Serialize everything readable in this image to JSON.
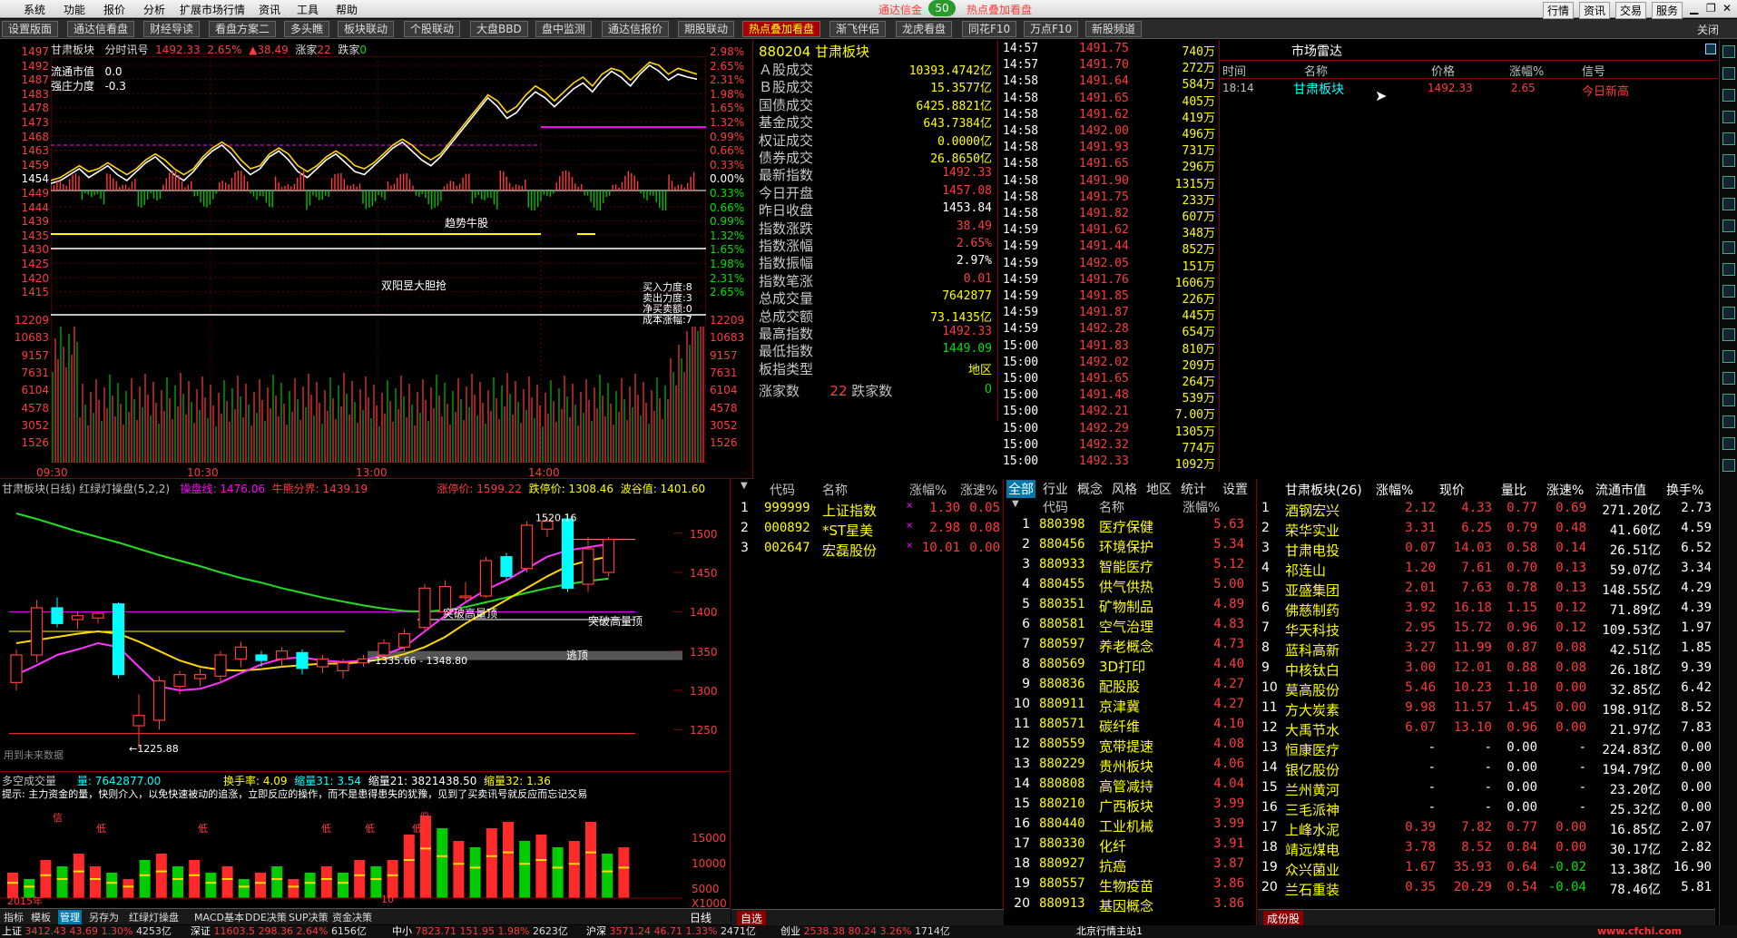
{
  "menu": {
    "items": [
      "系统",
      "功能",
      "报价",
      "分析",
      "扩展市场行情",
      "资讯",
      "工具",
      "帮助"
    ],
    "top_alerts": [
      "通达信金",
      "热点叠加看盘"
    ],
    "badge": "50",
    "right_buttons": [
      "行情",
      "资讯",
      "交易",
      "服务"
    ]
  },
  "tabs": [
    "设置版面",
    "通达信看盘",
    "财经导读",
    "看盘方案二",
    "多头瞧",
    "板块联动",
    "个股联动",
    "大盘BBD",
    "盘中监测",
    "通达信报价",
    "期股联动",
    "热点叠加看盘",
    "渐飞伴侣",
    "龙虎看盘",
    "同花F10",
    "万点F10",
    "新股频道"
  ],
  "active_tab": "热点叠加看盘",
  "close_label": "关闭",
  "intraday": {
    "header": {
      "name": "甘肃板块",
      "mode": "分时讯号",
      "price": "1492.33",
      "pct": "2.65%",
      "chg": "▲38.49",
      "up_label": "涨家",
      "up": "22",
      "down_label": "跌家",
      "down": "0"
    },
    "overlay1": [
      "流通市值",
      "0.0"
    ],
    "overlay2": [
      "强庄力度",
      "-0.3"
    ],
    "left_ticks": [
      "1497",
      "1492",
      "1487",
      "1483",
      "1478",
      "1473",
      "1468",
      "1463",
      "1459",
      "1454",
      "1449",
      "1444",
      "1439",
      "1435",
      "1430",
      "1425",
      "1420",
      "1415",
      "12209",
      "10683",
      "9157",
      "7631",
      "6104",
      "4578",
      "3052",
      "1526"
    ],
    "right_ticks": [
      "2.98%",
      "2.65%",
      "2.31%",
      "1.98%",
      "1.65%",
      "1.32%",
      "0.99%",
      "0.66%",
      "0.33%",
      "0.00%",
      "0.33%",
      "0.66%",
      "0.99%",
      "1.32%",
      "1.65%",
      "1.98%",
      "2.31%",
      "2.65%",
      "12209",
      "10683",
      "9157",
      "7631",
      "6104",
      "4578",
      "3052",
      "1526"
    ],
    "time_labels": [
      "09:30",
      "10:30",
      "13:00",
      "14:00"
    ],
    "annotations": {
      "trend": "趋势牛股",
      "yang": "双阳昱大胆抢",
      "buy": "买入力度:8",
      "sell": "卖出力度:3",
      "net": "净买卖额:0",
      "cost": "成本涨幅:7"
    },
    "series": {
      "price_white": [
        1457,
        1458,
        1460,
        1462,
        1459,
        1461,
        1463,
        1460,
        1458,
        1461,
        1464,
        1466,
        1463,
        1460,
        1458,
        1461,
        1465,
        1468,
        1470,
        1467,
        1463,
        1460,
        1462,
        1466,
        1468,
        1465,
        1461,
        1459,
        1462,
        1465,
        1467,
        1464,
        1461,
        1460,
        1463,
        1466,
        1469,
        1471,
        1468,
        1465,
        1463,
        1466,
        1470,
        1474,
        1478,
        1482,
        1486,
        1483,
        1479,
        1481,
        1485,
        1488,
        1486,
        1483,
        1486,
        1489,
        1491,
        1488,
        1492,
        1495,
        1493,
        1490,
        1494,
        1497,
        1495,
        1492,
        1494,
        1493,
        1492.3
      ],
      "avg_yellow": [
        1458,
        1459,
        1461,
        1463,
        1461,
        1462,
        1464,
        1462,
        1460,
        1462,
        1465,
        1467,
        1465,
        1462,
        1460,
        1462,
        1466,
        1469,
        1471,
        1469,
        1465,
        1462,
        1463,
        1467,
        1469,
        1467,
        1463,
        1461,
        1463,
        1466,
        1468,
        1466,
        1463,
        1462,
        1464,
        1467,
        1470,
        1472,
        1470,
        1467,
        1465,
        1467,
        1471,
        1475,
        1479,
        1483,
        1487,
        1485,
        1481,
        1483,
        1487,
        1490,
        1488,
        1485,
        1488,
        1491,
        1493,
        1490,
        1494,
        1496,
        1495,
        1492,
        1495,
        1498,
        1497,
        1494,
        1496,
        1495,
        1494
      ]
    }
  },
  "quote": {
    "code": "880204",
    "name": "甘肃板块",
    "rows": [
      [
        "Ａ股成交",
        "10393.4742亿",
        "yel"
      ],
      [
        "Ｂ股成交",
        "15.3577亿",
        "yel"
      ],
      [
        "国债成交",
        "6425.8821亿",
        "yel"
      ],
      [
        "基金成交",
        "643.7384亿",
        "yel"
      ],
      [
        "权证成交",
        "0.0000亿",
        "yel"
      ],
      [
        "债券成交",
        "26.8650亿",
        "yel"
      ],
      [
        "最新指数",
        "1492.33",
        "red"
      ],
      [
        "今日开盘",
        "1457.08",
        "red"
      ],
      [
        "昨日收盘",
        "1453.84",
        "wht"
      ],
      [
        "指数涨跌",
        "38.49",
        "red"
      ],
      [
        "指数涨幅",
        "2.65%",
        "red"
      ],
      [
        "指数振幅",
        "2.97%",
        "wht"
      ],
      [
        "指数笔涨",
        "0.01",
        "red"
      ],
      [
        "总成交量",
        "7642877",
        "yel"
      ],
      [
        "总成交额",
        "73.1435亿",
        "yel"
      ],
      [
        "最高指数",
        "1492.33",
        "red"
      ],
      [
        "最低指数",
        "1449.09",
        "grn"
      ],
      [
        "板指类型",
        "地区",
        "yel"
      ]
    ],
    "updown_label": "涨家数",
    "up": "22",
    "down_label": "跌家数",
    "down": "0"
  },
  "ticks": [
    [
      "14:57",
      "1491.75",
      "740万"
    ],
    [
      "14:57",
      "1491.70",
      "272万"
    ],
    [
      "14:58",
      "1491.64",
      "584万"
    ],
    [
      "14:58",
      "1491.65",
      "405万"
    ],
    [
      "14:58",
      "1491.62",
      "419万"
    ],
    [
      "14:58",
      "1492.00",
      "496万"
    ],
    [
      "14:58",
      "1491.93",
      "731万"
    ],
    [
      "14:58",
      "1491.65",
      "296万"
    ],
    [
      "14:58",
      "1491.90",
      "1315万"
    ],
    [
      "14:58",
      "1491.75",
      "233万"
    ],
    [
      "14:58",
      "1491.82",
      "607万"
    ],
    [
      "14:59",
      "1491.62",
      "348万"
    ],
    [
      "14:59",
      "1491.44",
      "852万"
    ],
    [
      "14:59",
      "1492.05",
      "151万"
    ],
    [
      "14:59",
      "1491.76",
      "1606万"
    ],
    [
      "14:59",
      "1491.85",
      "226万"
    ],
    [
      "14:59",
      "1491.87",
      "445万"
    ],
    [
      "14:59",
      "1492.28",
      "654万"
    ],
    [
      "15:00",
      "1491.83",
      "810万"
    ],
    [
      "15:00",
      "1492.02",
      "209万"
    ],
    [
      "15:00",
      "1491.65",
      "264万"
    ],
    [
      "15:00",
      "1491.48",
      "539万"
    ],
    [
      "15:00",
      "1492.21",
      "7.00万"
    ],
    [
      "15:00",
      "1492.29",
      "1305万"
    ],
    [
      "15:00",
      "1492.32",
      "774万"
    ],
    [
      "15:00",
      "1492.33",
      "1092万"
    ]
  ],
  "radar": {
    "title": "市场雷达",
    "headers": [
      "时间",
      "名称",
      "价格",
      "涨幅%",
      "信号"
    ],
    "row": [
      "18:14",
      "甘肃板块",
      "1492.33",
      "2.65",
      "今日新高"
    ]
  },
  "kline": {
    "header": {
      "name": "甘肃板块(日线) 红绿灯操盘(5,2,2)",
      "l1": "操盘线: 1476.06",
      "l2": "牛熊分界: 1439.19",
      "l3": "涨停价: 1599.22",
      "l4": "跌停价: 1308.46",
      "l5": "波谷值: 1401.60"
    },
    "yticks": [
      "1500",
      "1450",
      "1400",
      "1350",
      "1300",
      "1250"
    ],
    "labels": {
      "high": "1520.16",
      "low": "1225.88",
      "range": "1335.66 - 1348.80",
      "tb1": "突破高量顶",
      "tb2": "突破高量顶",
      "top": "逃顶",
      "future": "用到未来数据"
    },
    "candles": [
      {
        "o": 1310,
        "h": 1352,
        "l": 1300,
        "c": 1345
      },
      {
        "o": 1345,
        "h": 1415,
        "l": 1335,
        "c": 1405
      },
      {
        "o": 1405,
        "h": 1418,
        "l": 1380,
        "c": 1385
      },
      {
        "o": 1390,
        "h": 1400,
        "l": 1378,
        "c": 1395
      },
      {
        "o": 1392,
        "h": 1400,
        "l": 1385,
        "c": 1398
      },
      {
        "o": 1410,
        "h": 1412,
        "l": 1315,
        "c": 1320
      },
      {
        "o": 1255,
        "h": 1295,
        "l": 1226,
        "c": 1268
      },
      {
        "o": 1262,
        "h": 1318,
        "l": 1250,
        "c": 1312
      },
      {
        "o": 1305,
        "h": 1325,
        "l": 1295,
        "c": 1320
      },
      {
        "o": 1315,
        "h": 1328,
        "l": 1305,
        "c": 1320
      },
      {
        "o": 1318,
        "h": 1350,
        "l": 1310,
        "c": 1345
      },
      {
        "o": 1340,
        "h": 1362,
        "l": 1330,
        "c": 1355
      },
      {
        "o": 1345,
        "h": 1350,
        "l": 1330,
        "c": 1338
      },
      {
        "o": 1340,
        "h": 1355,
        "l": 1330,
        "c": 1350
      },
      {
        "o": 1348,
        "h": 1352,
        "l": 1320,
        "c": 1328
      },
      {
        "o": 1330,
        "h": 1345,
        "l": 1322,
        "c": 1340
      },
      {
        "o": 1325,
        "h": 1340,
        "l": 1315,
        "c": 1335
      },
      {
        "o": 1335,
        "h": 1345,
        "l": 1330,
        "c": 1340
      },
      {
        "o": 1345,
        "h": 1365,
        "l": 1340,
        "c": 1360
      },
      {
        "o": 1355,
        "h": 1378,
        "l": 1350,
        "c": 1372
      },
      {
        "o": 1380,
        "h": 1435,
        "l": 1375,
        "c": 1430
      },
      {
        "o": 1400,
        "h": 1440,
        "l": 1395,
        "c": 1432
      },
      {
        "o": 1418,
        "h": 1438,
        "l": 1412,
        "c": 1420
      },
      {
        "o": 1420,
        "h": 1470,
        "l": 1418,
        "c": 1465
      },
      {
        "o": 1470,
        "h": 1475,
        "l": 1440,
        "c": 1445
      },
      {
        "o": 1455,
        "h": 1515,
        "l": 1450,
        "c": 1510
      },
      {
        "o": 1505,
        "h": 1520,
        "l": 1495,
        "c": 1515
      },
      {
        "o": 1518,
        "h": 1525,
        "l": 1425,
        "c": 1430
      },
      {
        "o": 1435,
        "h": 1495,
        "l": 1425,
        "c": 1480
      },
      {
        "o": 1450,
        "h": 1495,
        "l": 1445,
        "c": 1492
      }
    ],
    "ma_magenta": [
      1320,
      1332,
      1345,
      1352,
      1360,
      1355,
      1330,
      1305,
      1300,
      1302,
      1310,
      1322,
      1333,
      1340,
      1342,
      1338,
      1336,
      1338,
      1345,
      1355,
      1375,
      1395,
      1412,
      1428,
      1440,
      1455,
      1470,
      1478,
      1482,
      1486
    ],
    "ma_yellow": [
      1360,
      1364,
      1368,
      1372,
      1375,
      1372,
      1362,
      1350,
      1338,
      1330,
      1326,
      1325,
      1327,
      1330,
      1332,
      1334,
      1334,
      1336,
      1340,
      1346,
      1355,
      1368,
      1385,
      1400,
      1415,
      1430,
      1445,
      1458,
      1465,
      1470
    ],
    "ma_green": [
      1525,
      1518,
      1510,
      1502,
      1495,
      1488,
      1480,
      1472,
      1465,
      1458,
      1450,
      1443,
      1437,
      1430,
      1424,
      1418,
      1413,
      1408,
      1404,
      1401,
      1400,
      1402,
      1406,
      1412,
      1418,
      1424,
      1430,
      1435,
      1439,
      1442
    ]
  },
  "volume": {
    "header": {
      "name": "多空成交量",
      "q": "量: 7642877.00",
      "turn": "换手率: 4.09",
      "s1": "缩量31: 3.54",
      "s2": "缩量21: 3821438.50",
      "s3": "缩量32: 1.36"
    },
    "desc": "提示: 主力资金的量，快则介入，以免快速被动的追涨，立即反应的操作，而不是患得患失的犹豫，见到了买卖讯号就反应而忘记交易",
    "marks": [
      "信",
      "低",
      "低",
      "低",
      "低",
      "低",
      "信"
    ],
    "yticks": [
      "15000",
      "10000",
      "5000",
      "X1000"
    ],
    "years": [
      "2015年",
      "10"
    ],
    "bars": [
      [
        4,
        "r"
      ],
      [
        3,
        "g"
      ],
      [
        6,
        "r"
      ],
      [
        5,
        "g"
      ],
      [
        7,
        "r"
      ],
      [
        5,
        "r"
      ],
      [
        4,
        "g"
      ],
      [
        3,
        "r"
      ],
      [
        6,
        "g"
      ],
      [
        7,
        "r"
      ],
      [
        5,
        "g"
      ],
      [
        6,
        "r"
      ],
      [
        4,
        "g"
      ],
      [
        5,
        "r"
      ],
      [
        3,
        "g"
      ],
      [
        4,
        "r"
      ],
      [
        5,
        "g"
      ],
      [
        3,
        "r"
      ],
      [
        4,
        "g"
      ],
      [
        5,
        "r"
      ],
      [
        4,
        "g"
      ],
      [
        6,
        "r"
      ],
      [
        5,
        "g"
      ],
      [
        6,
        "r"
      ],
      [
        10,
        "r"
      ],
      [
        13,
        "r"
      ],
      [
        11,
        "g"
      ],
      [
        9,
        "r"
      ],
      [
        8,
        "g"
      ],
      [
        11,
        "r"
      ],
      [
        12,
        "r"
      ],
      [
        9,
        "g"
      ],
      [
        10,
        "r"
      ],
      [
        8,
        "g"
      ],
      [
        9,
        "r"
      ],
      [
        12,
        "r"
      ],
      [
        7,
        "g"
      ],
      [
        8,
        "r"
      ]
    ]
  },
  "bottom_tabs": [
    "指标",
    "模板",
    "管理",
    "另存为",
    "红绿灯操盘",
    "MACD基本",
    "DDE决策",
    "SUP决策",
    "资金决策"
  ],
  "period_label": "日线",
  "watch": {
    "headers": [
      "代码",
      "名称",
      "涨幅%",
      "涨速%"
    ],
    "rows": [
      [
        "1",
        "999999",
        "上证指数",
        "1.30",
        "0.05"
      ],
      [
        "2",
        "000892",
        "*ST星美",
        "2.98",
        "0.08"
      ],
      [
        "3",
        "002647",
        "宏磊股份",
        "10.01",
        "0.00"
      ]
    ],
    "footer": "自选"
  },
  "sector": {
    "tabs": [
      "全部",
      "行业",
      "概念",
      "风格",
      "地区",
      "统计",
      "设置"
    ],
    "headers": [
      "代码",
      "名称",
      "涨幅%"
    ],
    "rows": [
      [
        "1",
        "880398",
        "医疗保健",
        "5.63"
      ],
      [
        "2",
        "880456",
        "环境保护",
        "5.34"
      ],
      [
        "3",
        "880933",
        "智能医疗",
        "5.12"
      ],
      [
        "4",
        "880455",
        "供气供热",
        "5.00"
      ],
      [
        "5",
        "880351",
        "矿物制品",
        "4.89"
      ],
      [
        "6",
        "880581",
        "空气治理",
        "4.83"
      ],
      [
        "7",
        "880597",
        "养老概念",
        "4.73"
      ],
      [
        "8",
        "880569",
        "3D打印",
        "4.40"
      ],
      [
        "9",
        "880836",
        "配股股",
        "4.27"
      ],
      [
        "10",
        "880911",
        "京津冀",
        "4.27"
      ],
      [
        "11",
        "880571",
        "碳纤维",
        "4.10"
      ],
      [
        "12",
        "880559",
        "宽带提速",
        "4.08"
      ],
      [
        "13",
        "880229",
        "贵州板块",
        "4.06"
      ],
      [
        "14",
        "880808",
        "高管减持",
        "4.04"
      ],
      [
        "15",
        "880210",
        "广西板块",
        "3.99"
      ],
      [
        "16",
        "880440",
        "工业机械",
        "3.99"
      ],
      [
        "17",
        "880330",
        "化纤",
        "3.91"
      ],
      [
        "18",
        "880927",
        "抗癌",
        "3.87"
      ],
      [
        "19",
        "880557",
        "生物疫苗",
        "3.86"
      ],
      [
        "20",
        "880913",
        "基因概念",
        "3.86"
      ]
    ]
  },
  "stocks": {
    "headers": [
      "甘肃板块(26)",
      "涨幅%",
      "现价",
      "量比",
      "涨速%",
      "流通市值",
      "换手%"
    ],
    "rows": [
      [
        "1",
        "酒钢宏兴",
        "2.12",
        "4.33",
        "0.77",
        "0.69",
        "271.20亿",
        "2.73"
      ],
      [
        "2",
        "荣华实业",
        "3.31",
        "6.25",
        "0.79",
        "0.48",
        "41.60亿",
        "4.59"
      ],
      [
        "3",
        "甘肃电投",
        "0.07",
        "14.03",
        "0.58",
        "0.14",
        "26.51亿",
        "6.52"
      ],
      [
        "4",
        "祁连山",
        "1.20",
        "7.61",
        "0.70",
        "0.13",
        "59.07亿",
        "3.34"
      ],
      [
        "5",
        "亚盛集团",
        "2.01",
        "7.63",
        "0.78",
        "0.13",
        "148.55亿",
        "4.29"
      ],
      [
        "6",
        "佛慈制药",
        "3.92",
        "16.18",
        "1.15",
        "0.12",
        "71.89亿",
        "4.39"
      ],
      [
        "7",
        "华天科技",
        "2.95",
        "15.72",
        "0.96",
        "0.12",
        "109.53亿",
        "1.97"
      ],
      [
        "8",
        "蓝科高新",
        "3.27",
        "11.99",
        "0.87",
        "0.08",
        "42.51亿",
        "1.85"
      ],
      [
        "9",
        "中核钛白",
        "3.00",
        "12.01",
        "0.88",
        "0.08",
        "26.18亿",
        "9.39"
      ],
      [
        "10",
        "莫高股份",
        "5.46",
        "10.23",
        "1.10",
        "0.00",
        "32.85亿",
        "6.42"
      ],
      [
        "11",
        "方大炭素",
        "9.98",
        "11.57",
        "1.45",
        "0.00",
        "198.91亿",
        "8.52"
      ],
      [
        "12",
        "大禹节水",
        "6.07",
        "13.10",
        "0.96",
        "0.00",
        "21.97亿",
        "7.83"
      ],
      [
        "13",
        "恒康医疗",
        "-",
        "-",
        "0.00",
        "-",
        "224.83亿",
        "0.00"
      ],
      [
        "14",
        "银亿股份",
        "-",
        "-",
        "0.00",
        "-",
        "194.79亿",
        "0.00"
      ],
      [
        "15",
        "兰州黄河",
        "-",
        "-",
        "0.00",
        "-",
        "23.20亿",
        "0.00"
      ],
      [
        "16",
        "三毛派神",
        "-",
        "-",
        "0.00",
        "-",
        "25.32亿",
        "0.00"
      ],
      [
        "17",
        "上峰水泥",
        "0.39",
        "7.82",
        "0.77",
        "0.00",
        "16.85亿",
        "2.07"
      ],
      [
        "18",
        "靖远煤电",
        "3.78",
        "8.52",
        "0.84",
        "0.00",
        "30.17亿",
        "2.82"
      ],
      [
        "19",
        "众兴菌业",
        "1.67",
        "35.93",
        "0.64",
        "-0.02",
        "13.38亿",
        "16.90"
      ],
      [
        "20",
        "兰石重装",
        "0.35",
        "20.29",
        "0.54",
        "-0.04",
        "78.46亿",
        "5.81"
      ]
    ],
    "footer": "成份股"
  },
  "status": {
    "items": [
      [
        "上证",
        "3412.43",
        "43.69",
        "1.30%",
        "4253亿"
      ],
      [
        "深证",
        "11603.5",
        "298.36",
        "2.64%",
        "6156亿"
      ],
      [
        "中小",
        "7823.71",
        "151.95",
        "1.98%",
        "2623亿"
      ],
      [
        "沪深",
        "3571.24",
        "46.71",
        "1.33%",
        "2471亿"
      ],
      [
        "创业",
        "2538.38",
        "80.24",
        "3.26%",
        "1714亿"
      ]
    ],
    "server": "北京行情主站1",
    "watermark": "www.cfchi.com"
  }
}
